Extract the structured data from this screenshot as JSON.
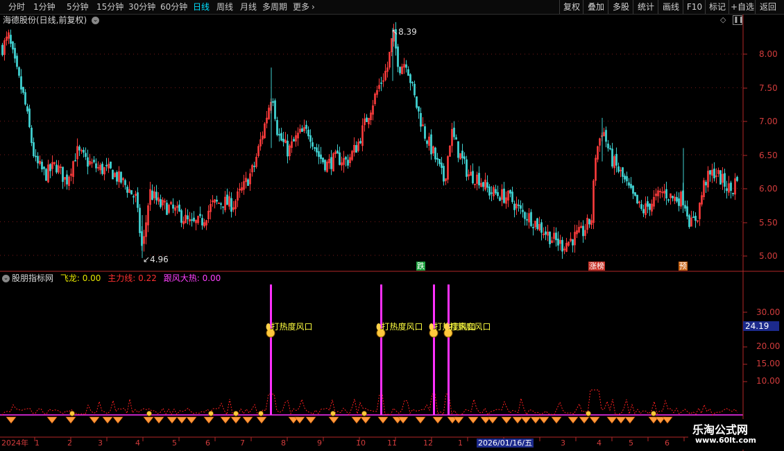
{
  "toolbar": {
    "periods": [
      "分时",
      "1分钟",
      "5分钟",
      "15分钟",
      "30分钟",
      "60分钟",
      "日线",
      "周线",
      "月线",
      "多周期",
      "更多"
    ],
    "active_period": "日线",
    "right_buttons": [
      "复权",
      "叠加",
      "多股",
      "统计",
      "画线",
      "F10",
      "标记",
      "+自选",
      "返回"
    ]
  },
  "stock": {
    "title": "海德股份(日线,前复权)",
    "high_label": "8.39",
    "low_label": "4.96"
  },
  "price_axis": [
    "8.00",
    "7.50",
    "7.00",
    "6.50",
    "6.00",
    "5.50",
    "5.00"
  ],
  "event_badges": [
    {
      "text": "跌",
      "color": "#1aa03c"
    },
    {
      "text": "涨榜",
      "color": "#c83228"
    },
    {
      "text": "预",
      "color": "#c86414"
    }
  ],
  "indicator": {
    "name": "股朋指标网",
    "vars": [
      {
        "name": "飞龙:",
        "value": "0.00",
        "color": "#e6e600"
      },
      {
        "name": "主力线:",
        "value": "0.22",
        "color": "#ff3030"
      },
      {
        "name": "跟风大热:",
        "value": "0.00",
        "color": "#ff40ff"
      }
    ],
    "axis": [
      "30.00",
      "25.00",
      "20.00",
      "15.00",
      "10.00"
    ],
    "current_value": "24.19",
    "signal_text": "打热度风口",
    "signals": 4
  },
  "timeline": {
    "year_label": "2024年",
    "months": [
      "1",
      "2",
      "3",
      "4",
      "5",
      "6",
      "7",
      "8",
      "9",
      "10",
      "11",
      "12",
      "1",
      "2",
      "3",
      "4",
      "5",
      "6",
      "7"
    ],
    "cursor_date": "2026/01/16/五"
  },
  "watermark": {
    "line1": "乐淘公式网",
    "line2": "www.60lt.com"
  },
  "colors": {
    "up": "#ff3c3c",
    "down": "#40d0d0",
    "accent": "#00e0ff",
    "axis": "#b42828",
    "magenta": "#ff30ff",
    "yellow": "#ffff40"
  },
  "icons": [
    "chevron-down-icon",
    "chevron-right-icon",
    "diamond-icon",
    "pause-icon",
    "money-bag-icon",
    "diamond-marker-icon"
  ]
}
